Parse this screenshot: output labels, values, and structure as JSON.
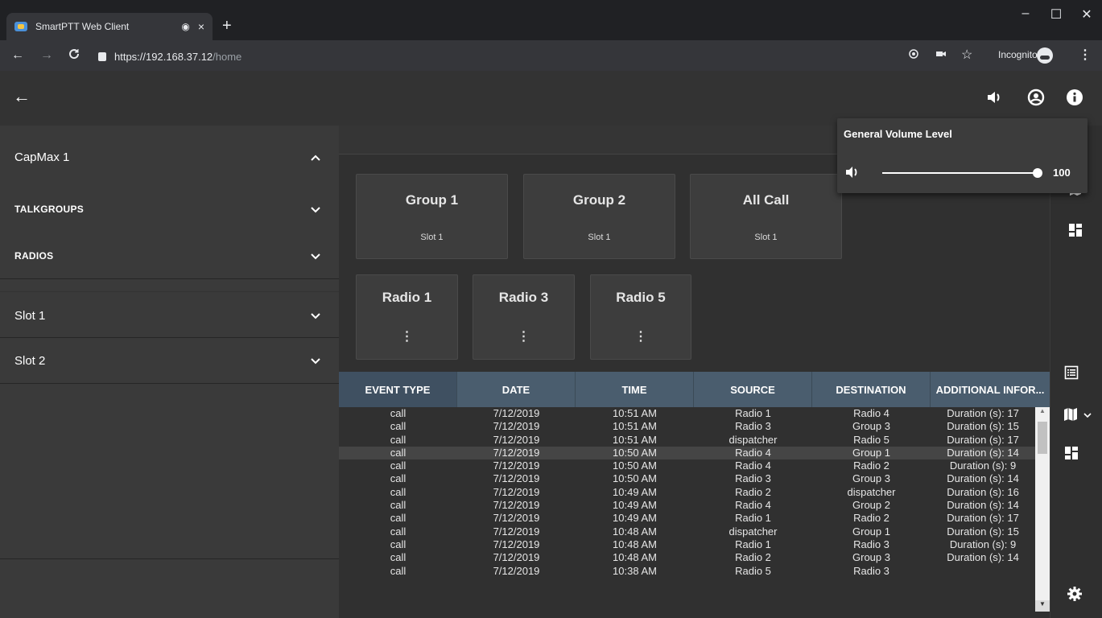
{
  "browser": {
    "tab_title": "SmartPTT Web Client",
    "tab_media_icon": "◉",
    "tab_close": "×",
    "new_tab": "+",
    "url_host": "https://192.168.37.12",
    "url_path": "/home",
    "incognito_label": "Incognito",
    "window_minimize": "–",
    "window_maximize": "☐",
    "window_close": "✕",
    "menu": "⋮"
  },
  "sidebar": {
    "system": "CapMax 1",
    "talkgroups": "TALKGROUPS",
    "radios": "RADIOS",
    "slot1": "Slot 1",
    "slot2": "Slot 2"
  },
  "group_tiles": [
    {
      "name": "Group 1",
      "slot": "Slot 1"
    },
    {
      "name": "Group 2",
      "slot": "Slot 1"
    },
    {
      "name": "All Call",
      "slot": "Slot 1"
    }
  ],
  "radio_tiles": [
    {
      "name": "Radio 1",
      "menu": "⋮"
    },
    {
      "name": "Radio 3",
      "menu": "⋮"
    },
    {
      "name": "Radio 5",
      "menu": "⋮"
    }
  ],
  "table": {
    "headers": [
      "EVENT TYPE",
      "DATE",
      "TIME",
      "SOURCE",
      "DESTINATION",
      "ADDITIONAL INFOR..."
    ],
    "rows": [
      [
        "call",
        "7/12/2019",
        "10:51 AM",
        "Radio 1",
        "Radio 4",
        "Duration (s): 17"
      ],
      [
        "call",
        "7/12/2019",
        "10:51 AM",
        "Radio 3",
        "Group 3",
        "Duration (s): 15"
      ],
      [
        "call",
        "7/12/2019",
        "10:51 AM",
        "dispatcher",
        "Radio 5",
        "Duration (s): 17"
      ],
      [
        "call",
        "7/12/2019",
        "10:50 AM",
        "Radio 4",
        "Group 1",
        "Duration (s): 14"
      ],
      [
        "call",
        "7/12/2019",
        "10:50 AM",
        "Radio 4",
        "Radio 2",
        "Duration (s): 9"
      ],
      [
        "call",
        "7/12/2019",
        "10:50 AM",
        "Radio 3",
        "Group 3",
        "Duration (s): 14"
      ],
      [
        "call",
        "7/12/2019",
        "10:49 AM",
        "Radio 2",
        "dispatcher",
        "Duration (s): 16"
      ],
      [
        "call",
        "7/12/2019",
        "10:49 AM",
        "Radio 4",
        "Group 2",
        "Duration (s): 14"
      ],
      [
        "call",
        "7/12/2019",
        "10:49 AM",
        "Radio 1",
        "Radio 2",
        "Duration (s): 17"
      ],
      [
        "call",
        "7/12/2019",
        "10:48 AM",
        "dispatcher",
        "Group 1",
        "Duration (s): 15"
      ],
      [
        "call",
        "7/12/2019",
        "10:48 AM",
        "Radio 1",
        "Radio 3",
        "Duration (s): 9"
      ],
      [
        "call",
        "7/12/2019",
        "10:48 AM",
        "Radio 2",
        "Group 3",
        "Duration (s): 14"
      ],
      [
        "call",
        "7/12/2019",
        "10:38 AM",
        "Radio 5",
        "Radio 3",
        ""
      ]
    ],
    "selected_row": 3
  },
  "volume": {
    "title": "General Volume Level",
    "value": "100",
    "level": 1.0
  },
  "icons": {
    "back": "←",
    "chevron_up": "^",
    "chevron_down": "v"
  }
}
